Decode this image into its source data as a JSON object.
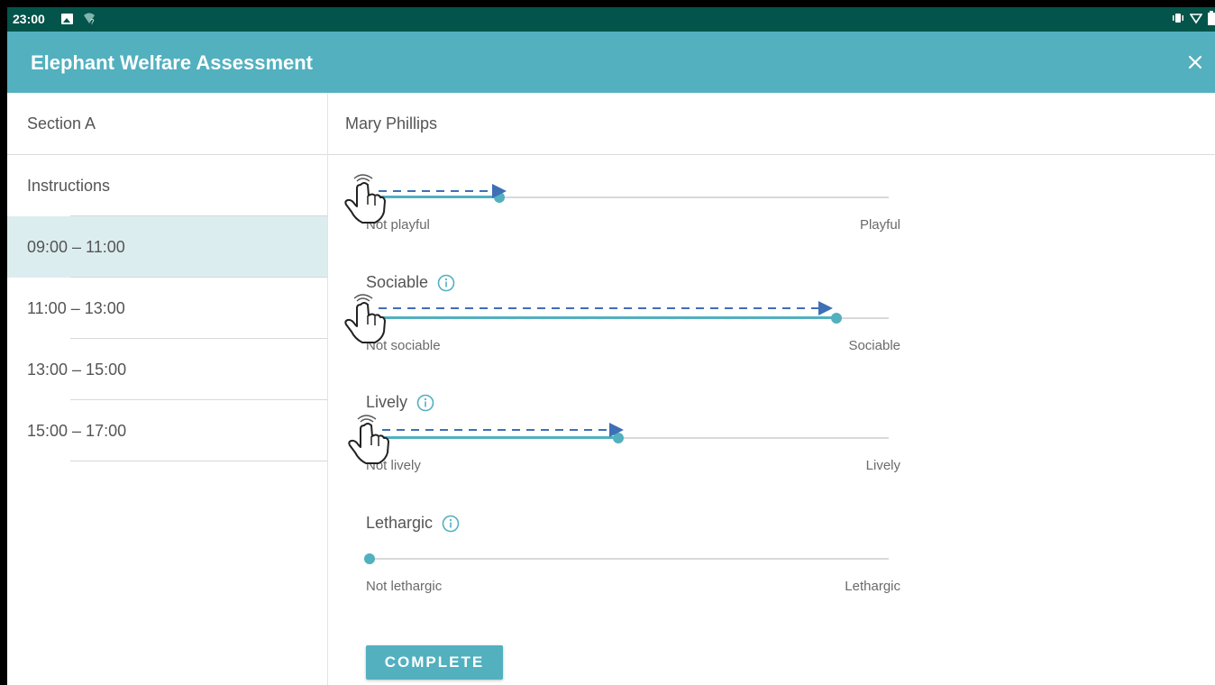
{
  "status_bar": {
    "time": "23:00"
  },
  "app_bar": {
    "title": "Elephant Welfare Assessment"
  },
  "sidebar": {
    "section_label": "Section A",
    "items": [
      {
        "label": "Instructions",
        "selected": false
      },
      {
        "label": "09:00 – 11:00",
        "selected": true
      },
      {
        "label": "11:00 – 13:00",
        "selected": false
      },
      {
        "label": "13:00 – 15:00",
        "selected": false
      },
      {
        "label": "15:00 – 17:00",
        "selected": false
      }
    ]
  },
  "main": {
    "assessor_name": "Mary Phillips",
    "questions": [
      {
        "title": "",
        "low_label": "Not playful",
        "high_label": "Playful",
        "value": 0.25,
        "has_info": false
      },
      {
        "title": "Sociable",
        "low_label": "Not sociable",
        "high_label": "Sociable",
        "value": 0.9,
        "has_info": true
      },
      {
        "title": "Lively",
        "low_label": "Not lively",
        "high_label": "Lively",
        "value": 0.48,
        "has_info": true
      },
      {
        "title": "Lethargic",
        "low_label": "Not lethargic",
        "high_label": "Lethargic",
        "value": 0.0,
        "has_info": true
      }
    ],
    "complete_label": "COMPLETE"
  },
  "colors": {
    "status_bar": "#03544a",
    "app_bar": "#52b0bf",
    "accent": "#52b0bf",
    "selected_row": "#dcedf0",
    "hint_arrow": "#3f6fb5"
  },
  "icons": {
    "close": "close-icon",
    "info": "info-icon",
    "gesture": "swipe-hand-icon"
  }
}
